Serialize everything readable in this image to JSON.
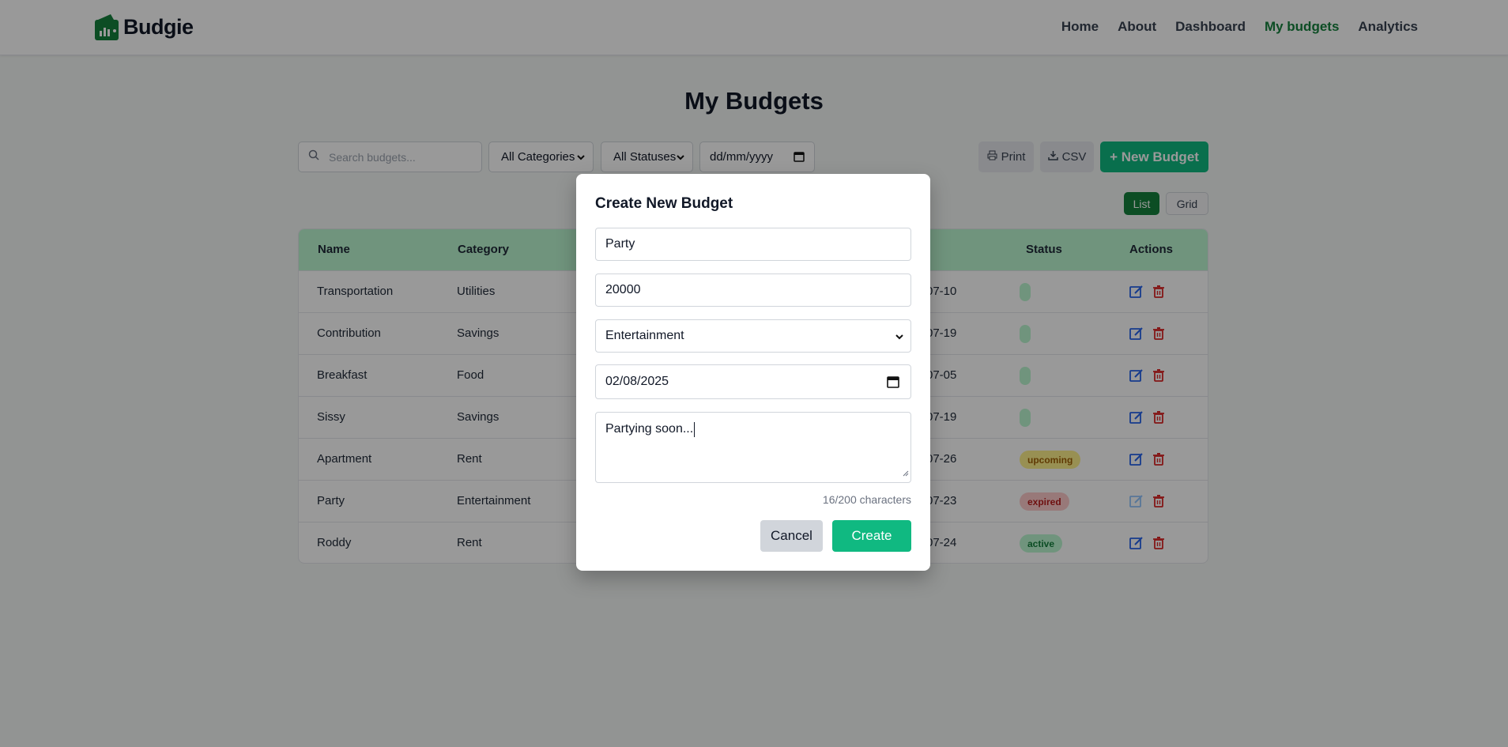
{
  "header": {
    "logo_text": "Budgie",
    "nav": [
      "Home",
      "About",
      "Dashboard",
      "My budgets",
      "Analytics"
    ],
    "active_nav": "My budgets"
  },
  "page": {
    "title": "My Budgets"
  },
  "toolbar": {
    "search_placeholder": "Search budgets...",
    "category_filter": "All Categories",
    "status_filter": "All Statuses",
    "date_filter": "dd/mm/yyyy",
    "print_label": "Print",
    "csv_label": "CSV",
    "new_budget_label": "+ New Budget"
  },
  "view_toggle": {
    "list": "List",
    "grid": "Grid",
    "active": "List"
  },
  "table": {
    "headers": [
      "Name",
      "Category",
      "Status",
      "Actions"
    ],
    "rows": [
      {
        "name": "Transportation",
        "category": "Utilities",
        "date": "07-10",
        "status": ""
      },
      {
        "name": "Contribution",
        "category": "Savings",
        "date": "07-19",
        "status": ""
      },
      {
        "name": "Breakfast",
        "category": "Food",
        "date": "07-05",
        "status": ""
      },
      {
        "name": "Sissy",
        "category": "Savings",
        "date": "07-19",
        "status": ""
      },
      {
        "name": "Apartment",
        "category": "Rent",
        "date": "07-26",
        "status": "upcoming"
      },
      {
        "name": "Party",
        "category": "Entertainment",
        "date": "07-23",
        "status": "expired"
      },
      {
        "name": "Roddy",
        "category": "Rent",
        "date": "07-24",
        "status": "active"
      }
    ]
  },
  "modal": {
    "title": "Create New Budget",
    "name_value": "Party",
    "amount_value": "20000",
    "category_value": "Entertainment",
    "date_value": "02/08/2025",
    "description_value": "Partying soon...",
    "char_counter": "16/200 characters",
    "cancel_label": "Cancel",
    "create_label": "Create"
  },
  "colors": {
    "brand": "#10b981",
    "brand_dark": "#15803d",
    "table_header": "#bbf7d0",
    "badge_upcoming": "#fef08a",
    "badge_expired": "#fecaca",
    "badge_active": "#bbf7d0",
    "edit_icon": "#2563eb",
    "delete_icon": "#dc2626"
  }
}
